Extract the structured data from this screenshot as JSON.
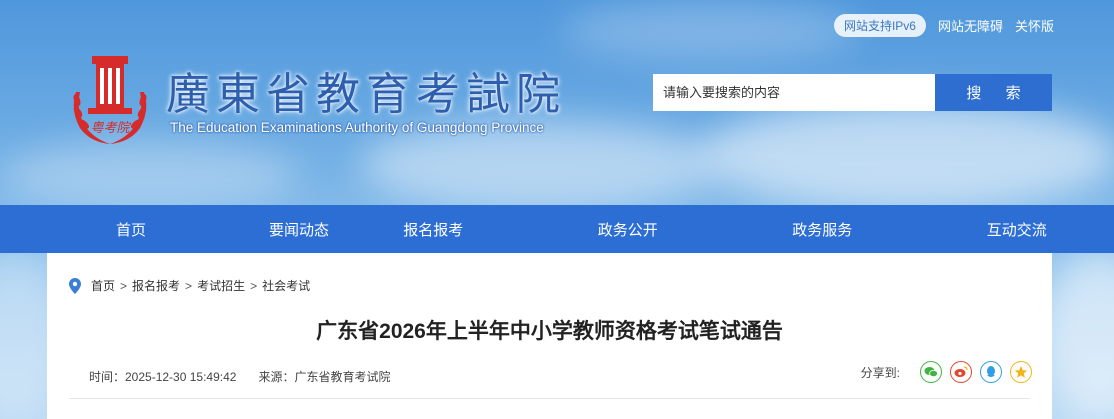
{
  "top_links": {
    "ipv6": "网站支持IPv6",
    "accessibility": "网站无障碍",
    "care": "关怀版"
  },
  "logo": {
    "title": "廣東省教育考試院",
    "subtitle": "The Education Examinations Authority of Guangdong Province",
    "emblem_text": "粤考院"
  },
  "search": {
    "placeholder": "请输入要搜索的内容",
    "button_label": "搜 索"
  },
  "nav": {
    "items": [
      {
        "label": "首页"
      },
      {
        "label": "要闻动态"
      },
      {
        "label": "报名报考"
      },
      {
        "label": "政务公开"
      },
      {
        "label": "政务服务"
      },
      {
        "label": "互动交流"
      }
    ]
  },
  "breadcrumb": {
    "items": [
      "首页",
      "报名报考",
      "考试招生",
      "社会考试"
    ],
    "separator": ">"
  },
  "article": {
    "title": "广东省2026年上半年中小学教师资格考试笔试通告",
    "time": "时间：2025-12-30 15:49:42",
    "source": "来源：广东省教育考试院"
  },
  "share": {
    "label": "分享到:",
    "icons": [
      "wechat-icon",
      "weibo-icon",
      "qq-icon",
      "qzone-icon"
    ]
  },
  "colors": {
    "nav_bg": "#2c6ed3",
    "search_button": "#2e6ed0",
    "emblem_red": "#d62b2b",
    "wechat": "#3fb53f",
    "weibo": "#e2462f",
    "qq": "#2f9ee6",
    "qzone": "#f2b31b"
  }
}
